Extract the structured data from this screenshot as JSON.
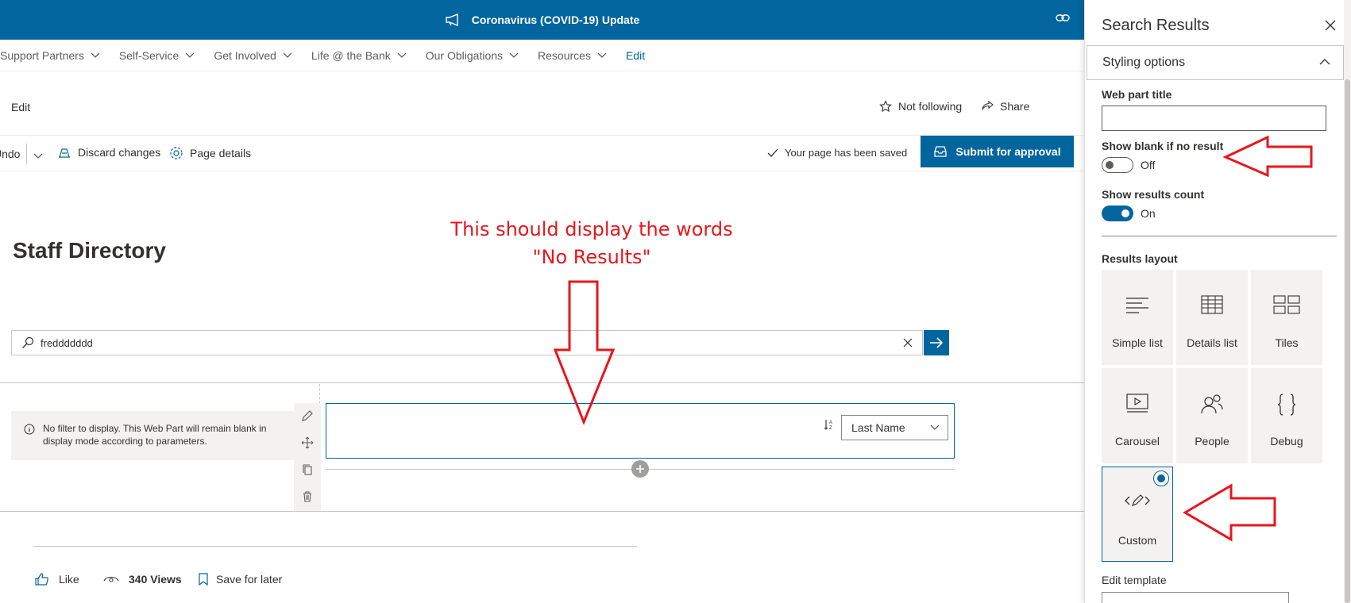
{
  "banner": {
    "title": "Coronavirus (COVID-19) Update"
  },
  "nav": {
    "items": [
      {
        "label": "Support Partners"
      },
      {
        "label": "Self-Service"
      },
      {
        "label": "Get Involved"
      },
      {
        "label": "Life @ the Bank"
      },
      {
        "label": "Our Obligations"
      },
      {
        "label": "Resources"
      }
    ],
    "edit_label": "Edit"
  },
  "command_bar": {
    "edit_label": "Edit",
    "follow_label": "Not following",
    "share_label": "Share"
  },
  "toolbar": {
    "undo_label": "Undo",
    "discard_label": "Discard changes",
    "details_label": "Page details",
    "saved_status": "Your page has been saved",
    "submit_label": "Submit for approval"
  },
  "page": {
    "title": "Staff Directory"
  },
  "annotation": {
    "line1": "This should display the words",
    "line2": "\"No Results\""
  },
  "search": {
    "value": "freddddddd"
  },
  "filter": {
    "message": "No filter to display. This Web Part will remain blank in display mode according to parameters."
  },
  "results": {
    "sort_value": "Last Name"
  },
  "footer": {
    "like_label": "Like",
    "views_count": "340",
    "views_label": "Views",
    "save_label": "Save for later"
  },
  "panel": {
    "title": "Search Results",
    "section": "Styling options",
    "web_part_title_label": "Web part title",
    "web_part_title_value": "",
    "show_blank_label": "Show blank if no result",
    "show_blank_state": "Off",
    "show_count_label": "Show results count",
    "show_count_state": "On",
    "results_layout_label": "Results layout",
    "layouts": [
      {
        "label": "Simple list",
        "icon": "simple-list-icon"
      },
      {
        "label": "Details list",
        "icon": "details-list-icon"
      },
      {
        "label": "Tiles",
        "icon": "tiles-icon"
      },
      {
        "label": "Carousel",
        "icon": "carousel-icon"
      },
      {
        "label": "People",
        "icon": "people-icon"
      },
      {
        "label": "Debug",
        "icon": "debug-braces-icon"
      },
      {
        "label": "Custom",
        "icon": "custom-edit-icon"
      }
    ],
    "selected_layout": "Custom",
    "edit_template_label": "Edit template"
  },
  "colors": {
    "brand": "#03659d",
    "annotation": "#e8161c",
    "panel_bg": "#f3f2f1"
  }
}
